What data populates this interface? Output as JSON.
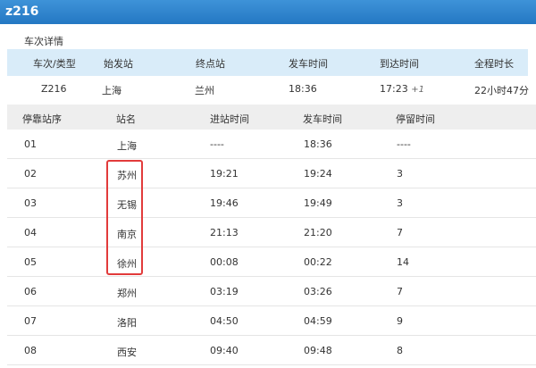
{
  "window_title": "z216",
  "section_label": "车次详情",
  "summary": {
    "headers": [
      "车次/类型",
      "始发站",
      "终点站",
      "发车时间",
      "到达时间",
      "全程时长"
    ],
    "values": {
      "train": "Z216",
      "origin": "上海",
      "destination": "兰州",
      "depart": "18:36",
      "arrive": "17:23",
      "arrive_day_offset": "+1",
      "duration": "22小时47分"
    }
  },
  "stops": {
    "headers": [
      "停靠站序",
      "站名",
      "进站时间",
      "发车时间",
      "停留时间"
    ],
    "rows": [
      {
        "seq": "01",
        "station": "上海",
        "arrive": "----",
        "depart": "18:36",
        "stay": "----"
      },
      {
        "seq": "02",
        "station": "苏州",
        "arrive": "19:21",
        "depart": "19:24",
        "stay": "3"
      },
      {
        "seq": "03",
        "station": "无锡",
        "arrive": "19:46",
        "depart": "19:49",
        "stay": "3"
      },
      {
        "seq": "04",
        "station": "南京",
        "arrive": "21:13",
        "depart": "21:20",
        "stay": "7"
      },
      {
        "seq": "05",
        "station": "徐州",
        "arrive": "00:08",
        "depart": "00:22",
        "stay": "14"
      },
      {
        "seq": "06",
        "station": "郑州",
        "arrive": "03:19",
        "depart": "03:26",
        "stay": "7"
      },
      {
        "seq": "07",
        "station": "洛阳",
        "arrive": "04:50",
        "depart": "04:59",
        "stay": "9"
      },
      {
        "seq": "08",
        "station": "西安",
        "arrive": "09:40",
        "depart": "09:48",
        "stay": "8"
      }
    ]
  },
  "highlight_color": "#e23b3b"
}
